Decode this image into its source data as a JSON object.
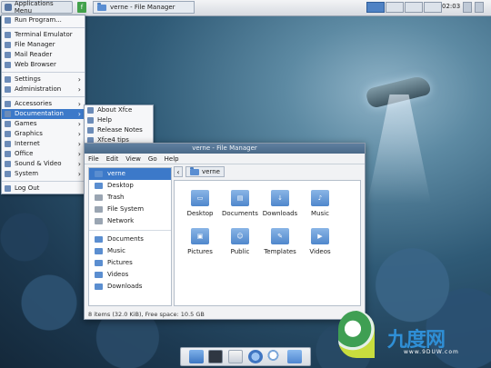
{
  "top_panel": {
    "app_menu_label": "Applications Menu",
    "launcher_label": "f",
    "task_title": "verne - File Manager",
    "clock": "02:03"
  },
  "app_menu": {
    "items": [
      {
        "label": "Run Program...",
        "icon": "run-program-icon",
        "has_submenu": false
      },
      {
        "label": "Terminal Emulator",
        "icon": "terminal-icon",
        "has_submenu": false
      },
      {
        "label": "File Manager",
        "icon": "file-manager-icon",
        "has_submenu": false
      },
      {
        "label": "Mail Reader",
        "icon": "mail-icon",
        "has_submenu": false
      },
      {
        "label": "Web Browser",
        "icon": "web-browser-icon",
        "has_submenu": false
      },
      {
        "label": "Settings",
        "icon": "settings-icon",
        "has_submenu": true
      },
      {
        "label": "Administration",
        "icon": "administration-icon",
        "has_submenu": true
      },
      {
        "label": "Accessories",
        "icon": "accessories-icon",
        "has_submenu": true
      },
      {
        "label": "Documentation",
        "icon": "documentation-icon",
        "has_submenu": true,
        "highlighted": true
      },
      {
        "label": "Games",
        "icon": "games-icon",
        "has_submenu": true
      },
      {
        "label": "Graphics",
        "icon": "graphics-icon",
        "has_submenu": true
      },
      {
        "label": "Internet",
        "icon": "internet-icon",
        "has_submenu": true
      },
      {
        "label": "Office",
        "icon": "office-icon",
        "has_submenu": true
      },
      {
        "label": "Sound & Video",
        "icon": "sound-video-icon",
        "has_submenu": true
      },
      {
        "label": "System",
        "icon": "system-icon",
        "has_submenu": true
      },
      {
        "label": "Log Out",
        "icon": "logout-icon",
        "has_submenu": false
      }
    ]
  },
  "doc_submenu": {
    "items": [
      {
        "label": "About Xfce",
        "icon": "about-icon"
      },
      {
        "label": "Help",
        "icon": "help-icon"
      },
      {
        "label": "Release Notes",
        "icon": "release-notes-icon"
      },
      {
        "label": "Xfce4 tips",
        "icon": "tips-icon"
      }
    ]
  },
  "file_manager": {
    "title": "verne - File Manager",
    "menu": [
      "File",
      "Edit",
      "View",
      "Go",
      "Help"
    ],
    "sidebar_places": [
      {
        "label": "verne",
        "icon": "home-folder-icon",
        "selected": true
      },
      {
        "label": "Desktop",
        "icon": "desktop-folder-icon"
      },
      {
        "label": "Trash",
        "icon": "trash-icon"
      },
      {
        "label": "File System",
        "icon": "filesystem-icon"
      },
      {
        "label": "Network",
        "icon": "network-icon"
      }
    ],
    "sidebar_folders": [
      {
        "label": "Documents",
        "icon": "documents-folder-icon"
      },
      {
        "label": "Music",
        "icon": "music-folder-icon"
      },
      {
        "label": "Pictures",
        "icon": "pictures-folder-icon"
      },
      {
        "label": "Videos",
        "icon": "videos-folder-icon"
      },
      {
        "label": "Downloads",
        "icon": "downloads-folder-icon"
      }
    ],
    "path_crumb": "verne",
    "items": [
      {
        "label": "Desktop",
        "icon": "desktop-folder-icon"
      },
      {
        "label": "Documents",
        "icon": "documents-folder-icon"
      },
      {
        "label": "Downloads",
        "icon": "downloads-folder-icon"
      },
      {
        "label": "Music",
        "icon": "music-folder-icon"
      },
      {
        "label": "Pictures",
        "icon": "pictures-folder-icon"
      },
      {
        "label": "Public",
        "icon": "public-folder-icon"
      },
      {
        "label": "Templates",
        "icon": "templates-folder-icon"
      },
      {
        "label": "Videos",
        "icon": "videos-folder-icon"
      }
    ],
    "status": "8 items (32.0 KiB), Free space: 10.5 GB"
  },
  "dock": {
    "icons": [
      "folder-icon",
      "terminal-icon",
      "text-editor-icon",
      "web-browser-icon",
      "search-icon",
      "folder-icon"
    ]
  },
  "watermark": {
    "cn_text": "九度网",
    "url": "www.9DUW.com"
  },
  "colors": {
    "accent": "#3c79c9",
    "panel_bg": "#e2e6eb"
  }
}
